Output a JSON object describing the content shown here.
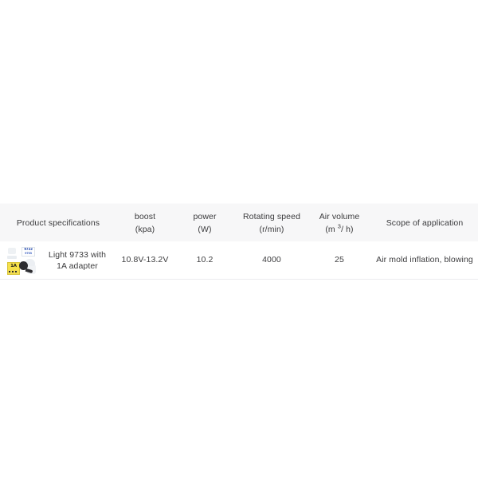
{
  "page": {
    "background_color": "#ffffff"
  },
  "spec_table": {
    "header_background": "#f7f7f8",
    "row_divider_color": "#ececee",
    "text_color": "#3c3c3e",
    "columns": [
      {
        "key": "spec",
        "line1": "Product specifications",
        "line2": ""
      },
      {
        "key": "boost",
        "line1": "boost",
        "line2": "(kpa)"
      },
      {
        "key": "power",
        "line1": "power",
        "line2": "(W)"
      },
      {
        "key": "rpm",
        "line1": "Rotating speed",
        "line2": "(r/min)"
      },
      {
        "key": "air",
        "line1": "Air volume",
        "line2": "(m ³/ h)"
      },
      {
        "key": "scope",
        "line1": "Scope of application",
        "line2": ""
      }
    ],
    "air_unit": {
      "prefix": "(m ",
      "superscript": "3",
      "suffix": "/ h)"
    },
    "rows": [
      {
        "thumbnail": {
          "icon": "product-photo-blower-with-adapter",
          "blue_label_line1": "9733",
          "blue_label_line2": "9733",
          "yellow_label": "1A"
        },
        "product_name": "Light 9733 with 1A adapter",
        "boost": "10.8V-13.2V",
        "power": "10.2",
        "rotating_speed": "4000",
        "air_volume": "25",
        "scope": "Air mold inflation, blowing"
      }
    ]
  }
}
